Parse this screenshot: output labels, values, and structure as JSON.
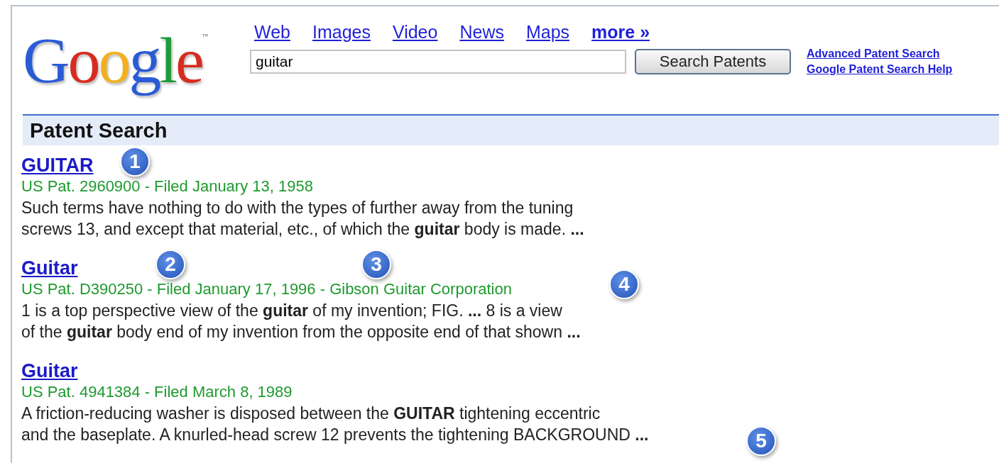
{
  "logo": {
    "text": "Google",
    "trademark": "™"
  },
  "nav_links": [
    {
      "label": "Web",
      "bold": false
    },
    {
      "label": "Images",
      "bold": false
    },
    {
      "label": "Video",
      "bold": false
    },
    {
      "label": "News",
      "bold": false
    },
    {
      "label": "Maps",
      "bold": false
    },
    {
      "label": "more »",
      "bold": true
    }
  ],
  "search": {
    "value": "guitar",
    "button": "Search Patents"
  },
  "side_links": [
    "Advanced Patent Search",
    "Google Patent Search Help"
  ],
  "section_title": "Patent Search",
  "results": [
    {
      "title": "GUITAR",
      "meta": "US Pat. 2960900 - Filed January 13, 1958",
      "snippet": [
        "Such terms have nothing to do with the types of further away from the tuning",
        "screws 13, and except that material, etc., of which the **guitar** body is made. **...**"
      ]
    },
    {
      "title": "Guitar",
      "meta": "US Pat. D390250 - Filed January 17, 1996 - Gibson Guitar Corporation",
      "snippet": [
        "1 is a top perspective view of the **guitar** of my invention; FIG. **...** 8 is a view",
        "of the **guitar** body end of my invention from the opposite end of that shown **...**"
      ]
    },
    {
      "title": "Guitar",
      "meta": "US Pat. 4941384 - Filed March 8, 1989",
      "snippet": [
        "A friction-reducing washer is disposed between the **GUITAR** tightening eccentric",
        "and the baseplate. A knurled-head screw 12 prevents the tightening BACKGROUND **...**"
      ]
    }
  ],
  "callouts": [
    "1",
    "2",
    "3",
    "4",
    "5"
  ]
}
